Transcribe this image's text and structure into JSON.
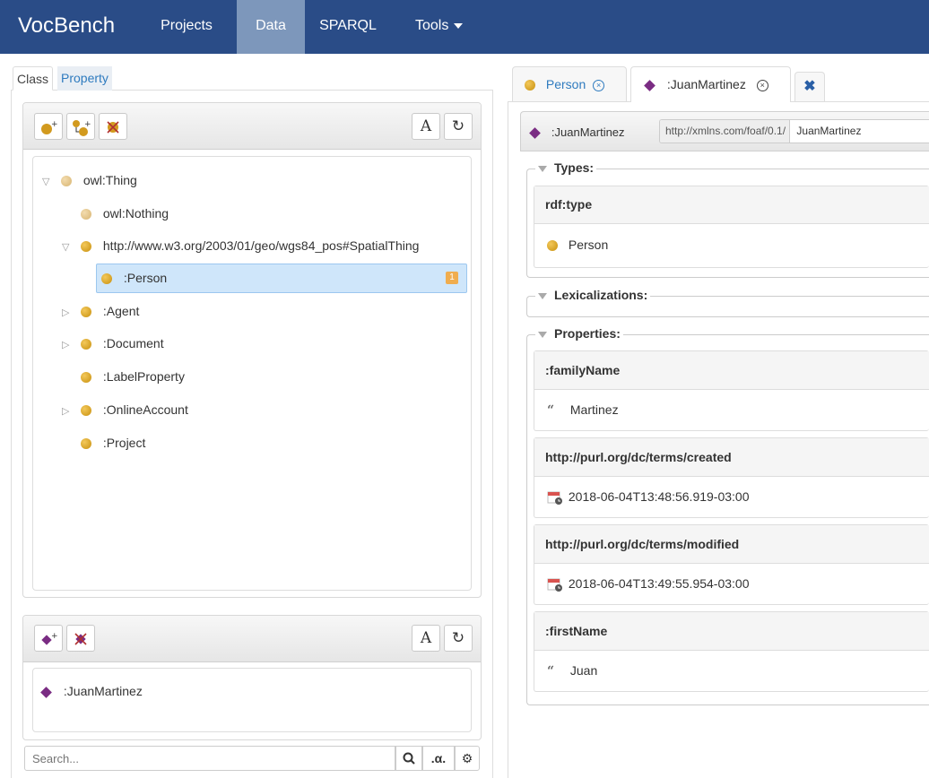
{
  "navbar": {
    "brand": "VocBench",
    "projects": "Projects",
    "data": "Data",
    "sparql": "SPARQL",
    "tools": "Tools"
  },
  "left": {
    "tabs": {
      "class": "Class",
      "property": "Property"
    },
    "class_tree": [
      {
        "label": "owl:Thing",
        "expanded": true
      },
      {
        "label": "owl:Nothing"
      },
      {
        "label": "http://www.w3.org/2003/01/geo/wgs84_pos#SpatialThing",
        "expanded": true
      },
      {
        "label": ":Person",
        "selected": true,
        "badge": "1"
      },
      {
        "label": ":Agent",
        "expandable": true
      },
      {
        "label": ":Document",
        "expandable": true
      },
      {
        "label": ":LabelProperty"
      },
      {
        "label": ":OnlineAccount",
        "expandable": true
      },
      {
        "label": ":Project"
      }
    ],
    "instances": [
      {
        "label": ":JuanMartinez"
      }
    ],
    "toolbar": {
      "alpha": "A",
      "refresh": "↻"
    },
    "search": {
      "placeholder": "Search...",
      "alpha_option": ".α."
    }
  },
  "right": {
    "tabs": {
      "person": "Person",
      "juan": ":JuanMartinez"
    },
    "resource": {
      "name": ":JuanMartinez",
      "namespace": "http://xmlns.com/foaf/0.1/",
      "local_name": "JuanMartinez"
    },
    "sections": {
      "types": "Types:",
      "lexicalizations": "Lexicalizations:",
      "properties": "Properties:"
    },
    "types": {
      "predicate": "rdf:type",
      "value": "Person"
    },
    "properties": [
      {
        "predicate": ":familyName",
        "value": "Martinez",
        "kind": "literal"
      },
      {
        "predicate": "http://purl.org/dc/terms/created",
        "value": "2018-06-04T13:48:56.919-03:00",
        "kind": "datetime"
      },
      {
        "predicate": "http://purl.org/dc/terms/modified",
        "value": "2018-06-04T13:49:55.954-03:00",
        "kind": "datetime"
      },
      {
        "predicate": ":firstName",
        "value": "Juan",
        "kind": "literal"
      }
    ]
  },
  "colors": {
    "navbar": "#2a4c87",
    "navbar_active": "#7d97bb",
    "selection": "#cfe6fa",
    "class_icon": "#d8a025",
    "instance_icon": "#7a2c83",
    "badge": "#f0ad4e"
  }
}
